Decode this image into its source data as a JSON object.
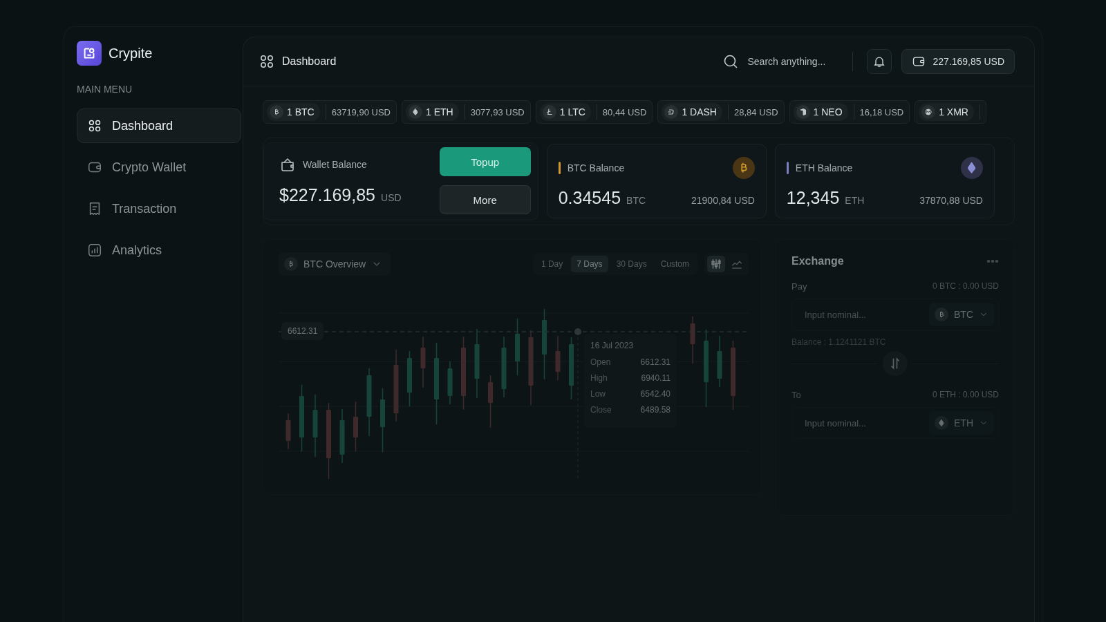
{
  "app": {
    "name": "Crypite"
  },
  "sidebar": {
    "heading": "MAIN MENU",
    "items": [
      {
        "label": "Dashboard",
        "kind": "grid",
        "selected": true
      },
      {
        "label": "Crypto Wallet",
        "kind": "wallet",
        "selected": false
      },
      {
        "label": "Transaction",
        "kind": "receipt",
        "selected": false
      },
      {
        "label": "Analytics",
        "kind": "chart",
        "selected": false
      }
    ]
  },
  "header": {
    "title": "Dashboard",
    "search": {
      "placeholder": "Search anything..."
    },
    "wallet_total": "227.169,85 USD"
  },
  "ticker": [
    {
      "kind": "btc",
      "amount": "1 BTC",
      "price": "63719,90 USD"
    },
    {
      "kind": "eth",
      "amount": "1 ETH",
      "price": "3077,93 USD"
    },
    {
      "kind": "ltc",
      "amount": "1 LTC",
      "price": "80,44 USD"
    },
    {
      "kind": "dash",
      "amount": "1 DASH",
      "price": "28,84 USD"
    },
    {
      "kind": "neo",
      "amount": "1 NEO",
      "price": "16,18 USD"
    },
    {
      "kind": "xmr",
      "amount": "1 XMR"
    }
  ],
  "wallet": {
    "label": "Wallet Balance",
    "amount": "$227.169,85",
    "unit": "USD",
    "buttons": [
      {
        "label": "Topup",
        "kind": "primary"
      },
      {
        "label": "More",
        "kind": "secondary"
      }
    ]
  },
  "balances": [
    {
      "kind": "btc",
      "label": "BTC Balance",
      "color": "#d29a2e",
      "amount": "0.34545",
      "unit": "BTC",
      "value": "21900,84 USD"
    },
    {
      "kind": "eth",
      "label": "ETH Balance",
      "color": "#7b7fc4",
      "amount": "12,345",
      "unit": "ETH",
      "value": "37870,88 USD"
    }
  ],
  "chart": {
    "selector": "BTC Overview",
    "ranges": [
      {
        "label": "1 Day",
        "selected": false
      },
      {
        "label": "7 Days",
        "selected": true
      },
      {
        "label": "30 Days",
        "selected": false
      },
      {
        "label": "Custom",
        "selected": false
      }
    ],
    "views": [
      {
        "kind": "candles",
        "selected": true
      },
      {
        "kind": "area",
        "selected": false
      }
    ],
    "price_label": "6612.31",
    "tooltip": {
      "date": "16 Jul 2023",
      "rows": [
        {
          "label": "Open",
          "value": "6612.31"
        },
        {
          "label": "High",
          "value": "6940.11"
        },
        {
          "label": "Low",
          "value": "6542.40"
        },
        {
          "label": "Close",
          "value": "6489.58"
        }
      ]
    }
  },
  "exchange": {
    "title": "Exchange",
    "pay": {
      "label": "Pay",
      "rate": "0 BTC : 0.00 USD",
      "placeholder": "Input nominal...",
      "kind": "btc",
      "currency": "BTC"
    },
    "balance": "Balance : 1.1241121 BTC",
    "to": {
      "label": "To",
      "rate": "0 ETH : 0.00 USD",
      "placeholder": "Input nominal...",
      "kind": "eth",
      "currency": "ETH"
    }
  }
}
